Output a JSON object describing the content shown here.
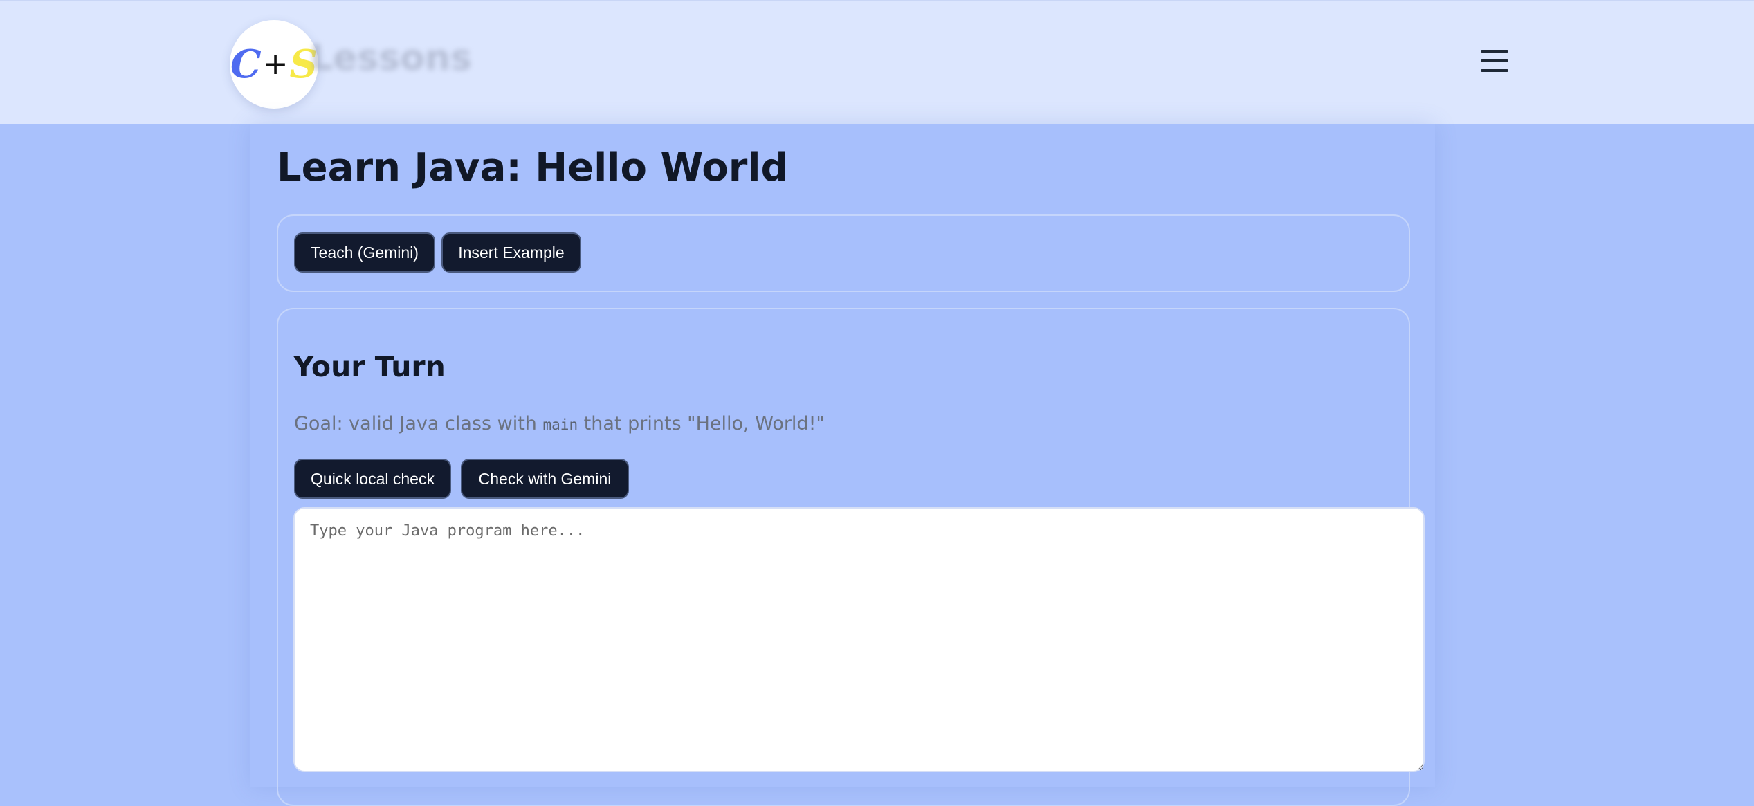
{
  "header": {
    "logo": {
      "letter_left": "C",
      "plus": "+",
      "letter_right": "S"
    },
    "brand_text": "Lessons",
    "menu_icon": "hamburger-menu-icon"
  },
  "page": {
    "title": "Learn Java: Hello World"
  },
  "actions": {
    "teach_label": "Teach (Gemini)",
    "insert_label": "Insert Example"
  },
  "your_turn": {
    "title": "Your Turn",
    "goal_prefix": "Goal: valid Java class with ",
    "goal_code": "main",
    "goal_suffix": " that prints \"Hello, World!\"",
    "quick_check_label": "Quick local check",
    "gemini_check_label": "Check with Gemini",
    "editor": {
      "placeholder": "Type your Java program here...",
      "value": ""
    }
  },
  "colors": {
    "page_background": "#a9c1fc",
    "header_background": "#dce6fe",
    "button_background": "#121a2e",
    "logo_c": "#4f6bf0",
    "logo_s": "#f7e948"
  }
}
